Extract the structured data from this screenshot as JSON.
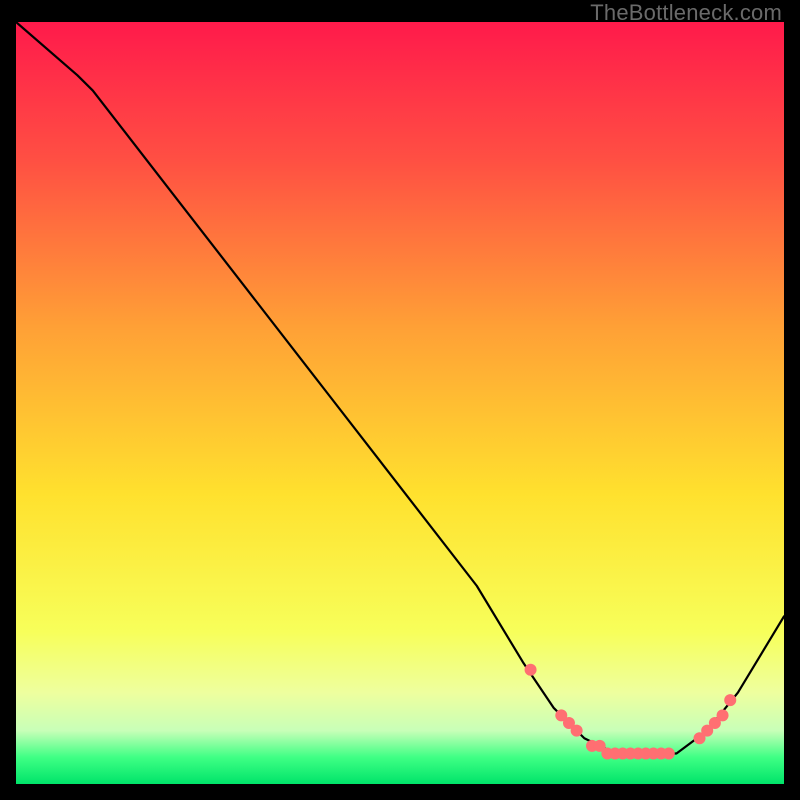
{
  "watermark": "TheBottleneck.com",
  "chart_data": {
    "type": "line",
    "title": "",
    "xlabel": "",
    "ylabel": "",
    "xlim": [
      0,
      100
    ],
    "ylim": [
      0,
      100
    ],
    "background_gradient": {
      "stops": [
        {
          "offset": 0.0,
          "color": "#ff1a4b"
        },
        {
          "offset": 0.18,
          "color": "#ff4f43"
        },
        {
          "offset": 0.4,
          "color": "#ffa036"
        },
        {
          "offset": 0.62,
          "color": "#ffe12e"
        },
        {
          "offset": 0.8,
          "color": "#f7ff5a"
        },
        {
          "offset": 0.88,
          "color": "#eeff9e"
        },
        {
          "offset": 0.93,
          "color": "#c8ffb8"
        },
        {
          "offset": 0.965,
          "color": "#3fff84"
        },
        {
          "offset": 1.0,
          "color": "#00e46a"
        }
      ]
    },
    "series": [
      {
        "name": "bottleneck-curve",
        "color": "#000000",
        "x": [
          0,
          8,
          10,
          20,
          30,
          40,
          50,
          60,
          66,
          70,
          74,
          78,
          82,
          86,
          90,
          94,
          100
        ],
        "y": [
          100,
          93,
          91,
          78,
          65,
          52,
          39,
          26,
          16,
          10,
          6,
          4,
          4,
          4,
          7,
          12,
          22
        ]
      }
    ],
    "markers": {
      "name": "highlighted-points",
      "color": "#ff6f72",
      "radius": 6,
      "x": [
        67,
        71,
        72,
        73,
        75,
        76,
        77,
        78,
        79,
        80,
        81,
        82,
        83,
        84,
        85,
        89,
        90,
        91,
        92,
        93
      ],
      "y": [
        15,
        9,
        8,
        7,
        5,
        5,
        4,
        4,
        4,
        4,
        4,
        4,
        4,
        4,
        4,
        6,
        7,
        8,
        9,
        11
      ]
    }
  }
}
